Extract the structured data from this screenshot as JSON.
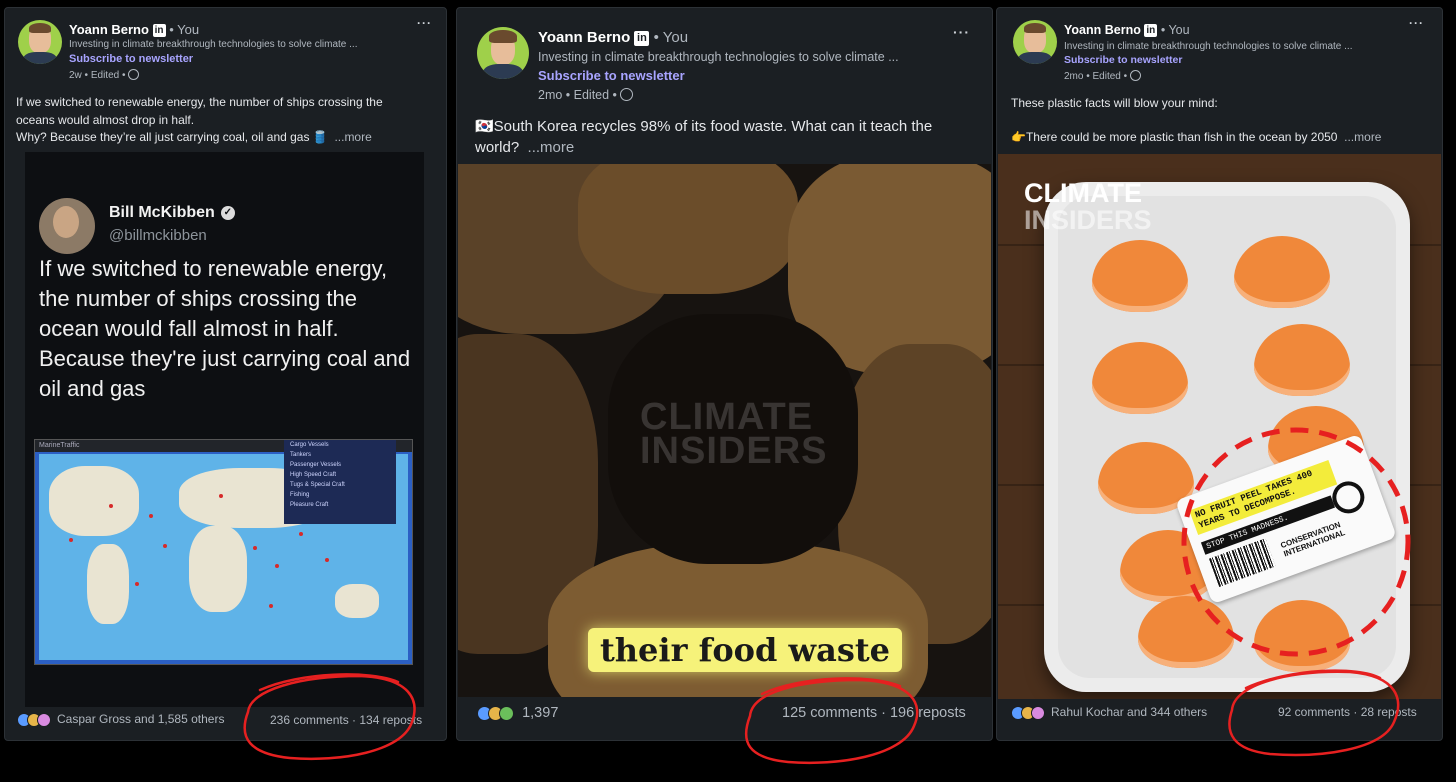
{
  "posts": [
    {
      "author": "Yoann Berno",
      "badge": "in",
      "you": "• You",
      "tagline": "Investing in climate breakthrough technologies to solve climate ...",
      "subscribe": "Subscribe to newsletter",
      "meta": "2w • Edited •",
      "menu": "···",
      "text_line1": "If we switched to renewable energy, the number of ships crossing the",
      "text_line2": "oceans would almost drop in half.",
      "text_line3": "Why? Because they’re all just carrying coal, oil and gas 🛢️",
      "more": "...more",
      "reactions": "Caspar Gross and 1,585 others",
      "stats": "236 comments · 134 reposts",
      "image": {
        "tweet_name": "Bill McKibben",
        "tweet_handle": "@billmckibben",
        "tweet_text": "If we switched to renewable energy, the number of ships crossing the ocean would fall almost in half. Because they're just carrying coal and oil and gas",
        "map_title": "MarineTraffic",
        "map_legend": [
          "Cargo Vessels",
          "Tankers",
          "Passenger Vessels",
          "High Speed Craft",
          "Tugs & Special Craft",
          "Fishing",
          "Pleasure Craft"
        ]
      }
    },
    {
      "author": "Yoann Berno",
      "badge": "in",
      "you": "• You",
      "tagline": "Investing in climate breakthrough technologies to solve climate ...",
      "subscribe": "Subscribe to newsletter",
      "meta": "2mo • Edited •",
      "menu": "···",
      "text_line1": "🇰🇷South Korea recycles 98% of its food waste. What can it teach the",
      "text_line2": "world?",
      "more": "...more",
      "reactions": "1,397",
      "stats": "125 comments · 196 reposts",
      "image": {
        "watermark_l1": "CLIMATE",
        "watermark_l2": "INSIDERS",
        "caption": "their food waste"
      }
    },
    {
      "author": "Yoann Berno",
      "badge": "in",
      "you": "• You",
      "tagline": "Investing in climate breakthrough technologies to solve climate ...",
      "subscribe": "Subscribe to newsletter",
      "meta": "2mo • Edited •",
      "menu": "···",
      "text_line1": "These plastic facts will blow your mind:",
      "text_line2": "👉There could be more plastic than fish in the ocean by 2050",
      "more": "...more",
      "reactions": "Rahul Kochar and 344 others",
      "stats": "92 comments · 28 reposts",
      "image": {
        "logo_l1": "CLIMATE",
        "logo_l2": "INSIDERS",
        "sticker_yellow": "NO FRUIT PEEL TAKES 400 YEARS TO DECOMPOSE.",
        "sticker_black": "STOP THIS MADNESS.",
        "sticker_org": "CONSERVATION INTERNATIONAL"
      }
    }
  ],
  "colors": {
    "card_bg": "#1b1f23",
    "accent_link": "#a8a4ff",
    "annotation_red": "#e62020"
  }
}
